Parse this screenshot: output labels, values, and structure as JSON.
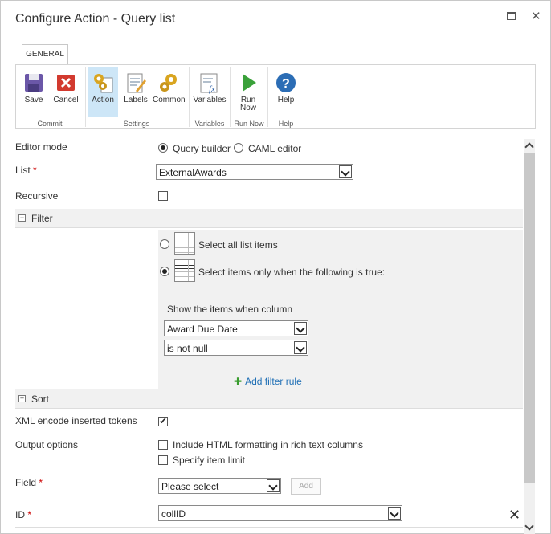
{
  "window": {
    "title": "Configure Action - Query list"
  },
  "ribbon": {
    "tab": "GENERAL",
    "buttons": {
      "save": "Save",
      "cancel": "Cancel",
      "action": "Action",
      "labels": "Labels",
      "common": "Common",
      "variables": "Variables",
      "run_now_1": "Run",
      "run_now_2": "Now",
      "help": "Help"
    },
    "groups": {
      "commit": "Commit",
      "settings": "Settings",
      "variables": "Variables",
      "run_now": "Run Now",
      "help": "Help"
    }
  },
  "form": {
    "editor_mode": {
      "label": "Editor mode",
      "option_query": "Query builder",
      "option_caml": "CAML editor",
      "selected": "Query builder"
    },
    "list": {
      "label": "List",
      "required": "*",
      "value": "ExternalAwards"
    },
    "recursive": {
      "label": "Recursive",
      "checked": false
    },
    "filter": {
      "title": "Filter",
      "toggle": "−",
      "option_all": "Select all list items",
      "option_some": "Select items only when the following is true:",
      "show_items": "Show the items when column",
      "column": "Award Due Date",
      "operator": "is not null",
      "add_rule": "Add filter rule"
    },
    "sort": {
      "title": "Sort",
      "toggle": "+"
    },
    "xml_encode": {
      "label": "XML encode inserted tokens",
      "checked": true,
      "mark": "✔"
    },
    "output": {
      "label": "Output options",
      "include_html": "Include HTML formatting in rich text columns",
      "item_limit": "Specify item limit"
    },
    "field": {
      "label": "Field",
      "required": "*",
      "value": "Please select",
      "add": "Add"
    },
    "id": {
      "label": "ID",
      "required": "*",
      "value": "collID"
    }
  }
}
